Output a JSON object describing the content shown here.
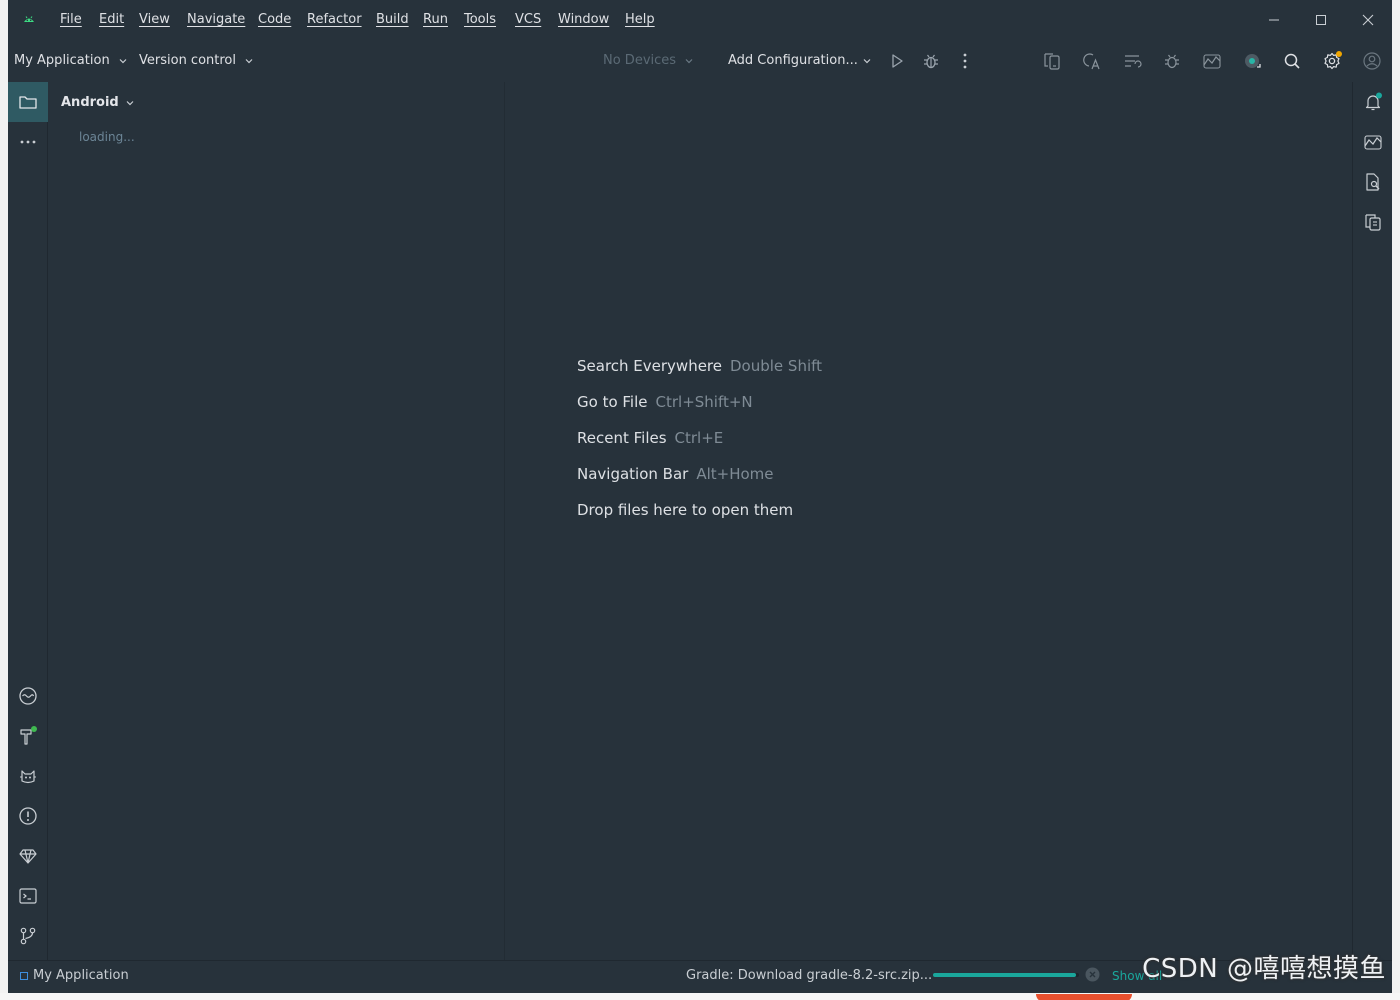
{
  "menu": {
    "items": [
      "File",
      "Edit",
      "View",
      "Navigate",
      "Code",
      "Refactor",
      "Build",
      "Run",
      "Tools",
      "VCS",
      "Window",
      "Help"
    ]
  },
  "window_controls": {
    "minimize_icon": "minimize-icon",
    "maximize_icon": "maximize-icon",
    "close_icon": "close-icon"
  },
  "toolbar": {
    "project_name": "My Application",
    "version_control": "Version control",
    "devices": "No Devices",
    "run_config": "Add Configuration...",
    "icons": [
      "run-icon",
      "debug-icon",
      "more-vertical-icon",
      "device-manager-icon",
      "translate-icon",
      "sync-icon",
      "profiler-icon",
      "app-inspection-icon",
      "gemini-icon",
      "search-icon",
      "settings-icon",
      "account-icon"
    ]
  },
  "left_strip": {
    "icons": [
      "project-folder-icon",
      "more-horizontal-icon",
      "logcat-icon",
      "build-icon",
      "app-quality-icon",
      "problems-icon",
      "gemini-icon",
      "terminal-icon",
      "git-icon"
    ]
  },
  "project_panel": {
    "view_mode": "Android",
    "loading": "loading..."
  },
  "editor": {
    "hints": [
      {
        "label": "Search Everywhere",
        "key": "Double Shift"
      },
      {
        "label": "Go to File",
        "key": "Ctrl+Shift+N"
      },
      {
        "label": "Recent Files",
        "key": "Ctrl+E"
      },
      {
        "label": "Navigation Bar",
        "key": "Alt+Home"
      },
      {
        "label": "Drop files here to open them",
        "key": ""
      }
    ]
  },
  "right_strip": {
    "icons": [
      "notifications-icon",
      "gemini-icon",
      "device-file-explorer-icon",
      "running-devices-icon"
    ]
  },
  "status": {
    "breadcrumb": "My Application",
    "gradle_task": "Gradle: Download gradle-8.2-src.zip...",
    "progress": 0.98,
    "show_all": "Show all"
  },
  "watermark": "CSDN @嘻嘻想摸鱼",
  "colors": {
    "background": "#27323b",
    "accent": "#1aa79c",
    "active_tool": "#2f5a63",
    "notification_dot": "#3fb950",
    "settings_dot": "#f0a500"
  }
}
